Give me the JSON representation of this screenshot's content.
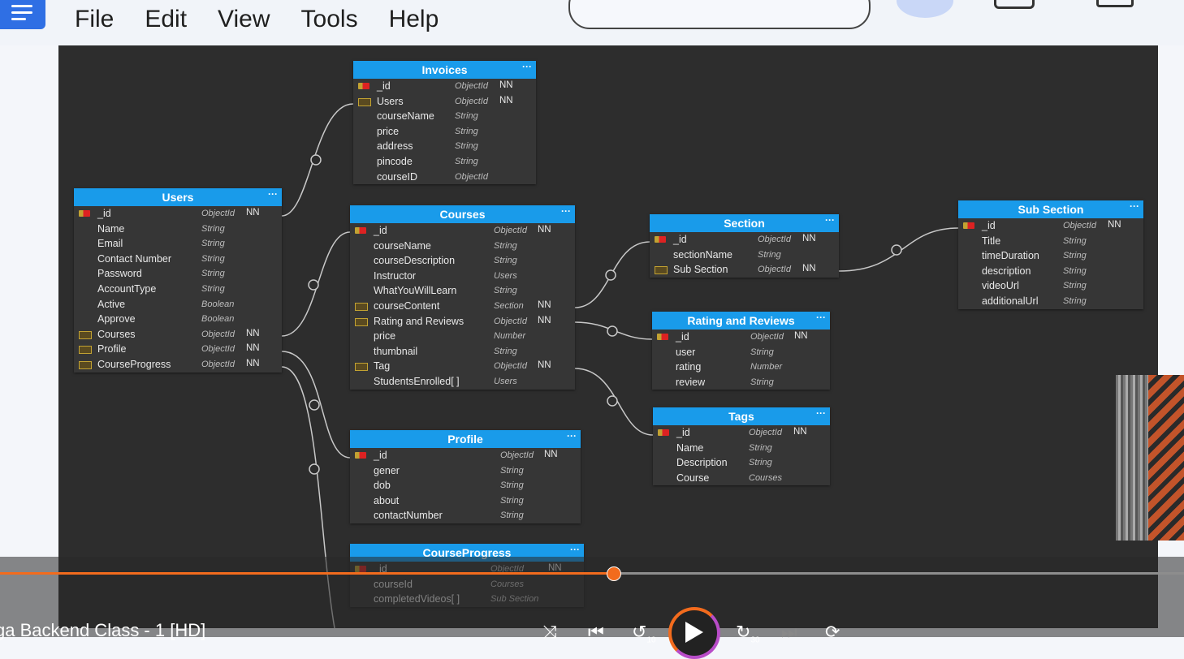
{
  "app": {
    "menu": [
      "File",
      "Edit",
      "View",
      "Tools",
      "Help"
    ]
  },
  "colors": {
    "canvas": "#2d2d2d",
    "entity_header": "#199bea",
    "entity_body": "#363636",
    "progress": "#f26b1d",
    "wire": "#c8c8c8"
  },
  "icons": {
    "primary_key": "key-icon",
    "reference": "reference-icon",
    "menu": "more-icon"
  },
  "diagram": {
    "entities": [
      {
        "id": "invoices",
        "title": "Invoices",
        "fields": [
          {
            "name": "_id",
            "type": "ObjectId",
            "nn": "NN",
            "icon": "key"
          },
          {
            "name": "Users",
            "type": "ObjectId",
            "nn": "NN",
            "icon": "ref"
          },
          {
            "name": "courseName",
            "type": "String",
            "nn": "",
            "icon": ""
          },
          {
            "name": "price",
            "type": "String",
            "nn": "",
            "icon": ""
          },
          {
            "name": "address",
            "type": "String",
            "nn": "",
            "icon": ""
          },
          {
            "name": "pincode",
            "type": "String",
            "nn": "",
            "icon": ""
          },
          {
            "name": "courseID",
            "type": "ObjectId",
            "nn": "",
            "icon": ""
          }
        ]
      },
      {
        "id": "users",
        "title": "Users",
        "fields": [
          {
            "name": "_id",
            "type": "ObjectId",
            "nn": "NN",
            "icon": "key"
          },
          {
            "name": "Name",
            "type": "String",
            "nn": "",
            "icon": ""
          },
          {
            "name": "Email",
            "type": "String",
            "nn": "",
            "icon": ""
          },
          {
            "name": "Contact Number",
            "type": "String",
            "nn": "",
            "icon": ""
          },
          {
            "name": "Password",
            "type": "String",
            "nn": "",
            "icon": ""
          },
          {
            "name": "AccountType",
            "type": "String",
            "nn": "",
            "icon": ""
          },
          {
            "name": "Active",
            "type": "Boolean",
            "nn": "",
            "icon": ""
          },
          {
            "name": "Approve",
            "type": "Boolean",
            "nn": "",
            "icon": ""
          },
          {
            "name": "Courses",
            "type": "ObjectId",
            "nn": "NN",
            "icon": "ref"
          },
          {
            "name": "Profile",
            "type": "ObjectId",
            "nn": "NN",
            "icon": "ref"
          },
          {
            "name": "CourseProgress",
            "type": "ObjectId",
            "nn": "NN",
            "icon": "ref"
          }
        ]
      },
      {
        "id": "courses",
        "title": "Courses",
        "fields": [
          {
            "name": "_id",
            "type": "ObjectId",
            "nn": "NN",
            "icon": "key"
          },
          {
            "name": "courseName",
            "type": "String",
            "nn": "",
            "icon": ""
          },
          {
            "name": "courseDescription",
            "type": "String",
            "nn": "",
            "icon": ""
          },
          {
            "name": "Instructor",
            "type": "Users",
            "nn": "",
            "icon": ""
          },
          {
            "name": "WhatYouWillLearn",
            "type": "String",
            "nn": "",
            "icon": ""
          },
          {
            "name": "courseContent",
            "type": "Section",
            "nn": "NN",
            "icon": "ref"
          },
          {
            "name": "Rating and Reviews",
            "type": "ObjectId",
            "nn": "NN",
            "icon": "ref"
          },
          {
            "name": "price",
            "type": "Number",
            "nn": "",
            "icon": ""
          },
          {
            "name": "thumbnail",
            "type": "String",
            "nn": "",
            "icon": ""
          },
          {
            "name": "Tag",
            "type": "ObjectId",
            "nn": "NN",
            "icon": "ref"
          },
          {
            "name": "StudentsEnrolled[ ]",
            "type": "Users",
            "nn": "",
            "icon": ""
          }
        ]
      },
      {
        "id": "section",
        "title": "Section",
        "fields": [
          {
            "name": "_id",
            "type": "ObjectId",
            "nn": "NN",
            "icon": "key"
          },
          {
            "name": "sectionName",
            "type": "String",
            "nn": "",
            "icon": ""
          },
          {
            "name": "Sub Section",
            "type": "ObjectId",
            "nn": "NN",
            "icon": "ref"
          }
        ]
      },
      {
        "id": "subsection",
        "title": "Sub Section",
        "fields": [
          {
            "name": "_id",
            "type": "ObjectId",
            "nn": "NN",
            "icon": "key"
          },
          {
            "name": "Title",
            "type": "String",
            "nn": "",
            "icon": ""
          },
          {
            "name": "timeDuration",
            "type": "String",
            "nn": "",
            "icon": ""
          },
          {
            "name": "description",
            "type": "String",
            "nn": "",
            "icon": ""
          },
          {
            "name": "videoUrl",
            "type": "String",
            "nn": "",
            "icon": ""
          },
          {
            "name": "additionalUrl",
            "type": "String",
            "nn": "",
            "icon": ""
          }
        ]
      },
      {
        "id": "rating",
        "title": "Rating and Reviews",
        "fields": [
          {
            "name": "_id",
            "type": "ObjectId",
            "nn": "NN",
            "icon": "key"
          },
          {
            "name": "user",
            "type": "String",
            "nn": "",
            "icon": ""
          },
          {
            "name": "rating",
            "type": "Number",
            "nn": "",
            "icon": ""
          },
          {
            "name": "review",
            "type": "String",
            "nn": "",
            "icon": ""
          }
        ]
      },
      {
        "id": "tags",
        "title": "Tags",
        "fields": [
          {
            "name": "_id",
            "type": "ObjectId",
            "nn": "NN",
            "icon": "key"
          },
          {
            "name": "Name",
            "type": "String",
            "nn": "",
            "icon": ""
          },
          {
            "name": "Description",
            "type": "String",
            "nn": "",
            "icon": ""
          },
          {
            "name": "Course",
            "type": "Courses",
            "nn": "",
            "icon": ""
          }
        ]
      },
      {
        "id": "profile",
        "title": "Profile",
        "fields": [
          {
            "name": "_id",
            "type": "ObjectId",
            "nn": "NN",
            "icon": "key"
          },
          {
            "name": "gener",
            "type": "String",
            "nn": "",
            "icon": ""
          },
          {
            "name": "dob",
            "type": "String",
            "nn": "",
            "icon": ""
          },
          {
            "name": "about",
            "type": "String",
            "nn": "",
            "icon": ""
          },
          {
            "name": "contactNumber",
            "type": "String",
            "nn": "",
            "icon": ""
          }
        ]
      },
      {
        "id": "courseprogress",
        "title": "CourseProgress",
        "fields": [
          {
            "name": "_id",
            "type": "ObjectId",
            "nn": "NN",
            "icon": "key"
          },
          {
            "name": "courseId",
            "type": "Courses",
            "nn": "",
            "icon": ""
          },
          {
            "name": "completedVideos[ ]",
            "type": "Sub Section",
            "nn": "",
            "icon": ""
          }
        ]
      }
    ]
  },
  "player": {
    "title": "ga Backend Class - 1 [HD]",
    "progress": 0.518,
    "controls": {
      "shuffle": "shuffle-icon",
      "previous": "previous-icon",
      "rewind": "rewind-10-icon",
      "play": "play-icon",
      "forward": "forward-30-icon",
      "next": "next-icon",
      "repeat": "repeat-icon"
    },
    "rewind_label": "10",
    "forward_label": "30"
  }
}
